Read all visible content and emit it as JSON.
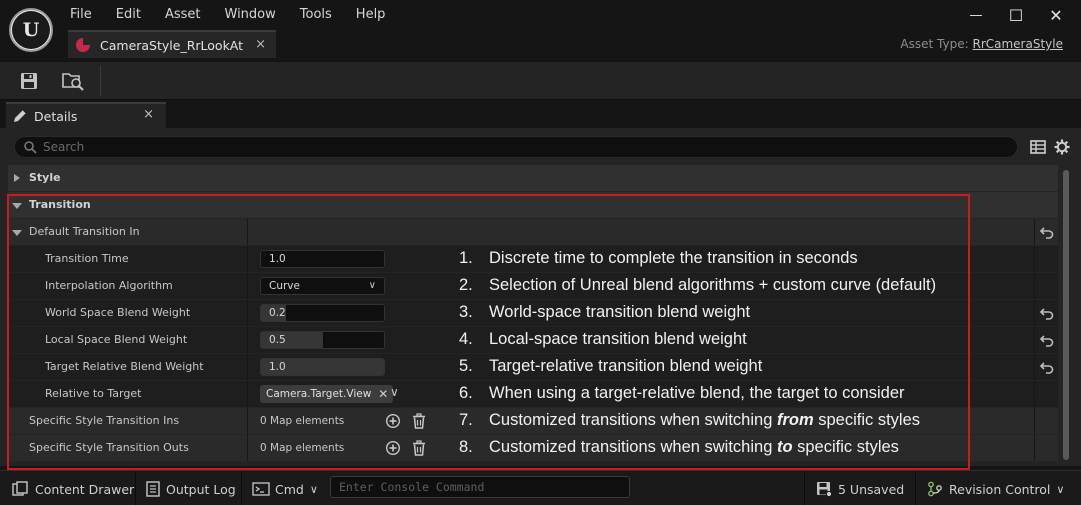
{
  "app": {
    "logo_icon": "unreal-engine-logo",
    "menu": [
      "File",
      "Edit",
      "Asset",
      "Window",
      "Tools",
      "Help"
    ],
    "document_tab": {
      "label": "CameraStyle_RrLookAt",
      "close": "×",
      "icon": "camera-style-asset-icon",
      "icon_color": "#c8294b"
    },
    "asset_type_label": "Asset Type:",
    "asset_type_value": "RrCameraStyle",
    "window_controls": {
      "minimize": "—",
      "maximize": "☐",
      "close": "✕"
    }
  },
  "toolbar": {
    "save_icon": "save-icon",
    "browse_icon": "browse-to-asset-icon"
  },
  "details_tab": {
    "label": "Details",
    "close": "×",
    "icon": "pencil-icon"
  },
  "search": {
    "placeholder": "Search"
  },
  "categories": {
    "style": "Style",
    "transition": "Transition"
  },
  "group": {
    "label": "Default Transition In"
  },
  "properties": {
    "transition_time": {
      "label": "Transition Time",
      "value": "1.0"
    },
    "interpolation_algorithm": {
      "label": "Interpolation Algorithm",
      "value": "Curve"
    },
    "world_space_blend_weight": {
      "label": "World Space Blend Weight",
      "value": "0.2",
      "fill": 0.2
    },
    "local_space_blend_weight": {
      "label": "Local Space Blend Weight",
      "value": "0.5",
      "fill": 0.5
    },
    "target_relative_blend_weight": {
      "label": "Target Relative Blend Weight",
      "value": "1.0",
      "fill": 1.0
    },
    "relative_to_target": {
      "label": "Relative to Target",
      "value": "Camera.Target.View"
    },
    "specific_style_transition_ins": {
      "label": "Specific Style Transition Ins",
      "value": "0 Map elements"
    },
    "specific_style_transition_outs": {
      "label": "Specific Style Transition Outs",
      "value": "0 Map elements"
    }
  },
  "annotations": [
    {
      "num": "1.",
      "text": "Discrete time to complete the transition in seconds"
    },
    {
      "num": "2.",
      "text": "Selection of Unreal blend algorithms + custom curve (default)"
    },
    {
      "num": "3.",
      "text": "World-space transition blend weight"
    },
    {
      "num": "4.",
      "text": "Local-space transition blend weight"
    },
    {
      "num": "5.",
      "text": "Target-relative transition blend weight"
    },
    {
      "num": "6.",
      "text": "When using a target-relative blend, the target to consider"
    },
    {
      "num": "7.",
      "pre": "Customized transitions when switching ",
      "em": "from",
      "post": " specific styles"
    },
    {
      "num": "8.",
      "pre": "Customized transitions when switching ",
      "em": "to",
      "post": " specific styles"
    }
  ],
  "statusbar": {
    "content_drawer": "Content Drawer",
    "output_log": "Output Log",
    "cmd": "Cmd",
    "console_placeholder": "Enter Console Command",
    "unsaved": "5 Unsaved",
    "revision_control": "Revision Control"
  },
  "colors": {
    "highlight_border": "#d0191b",
    "panel_bg": "#242424",
    "accent_asset": "#c8294b"
  }
}
